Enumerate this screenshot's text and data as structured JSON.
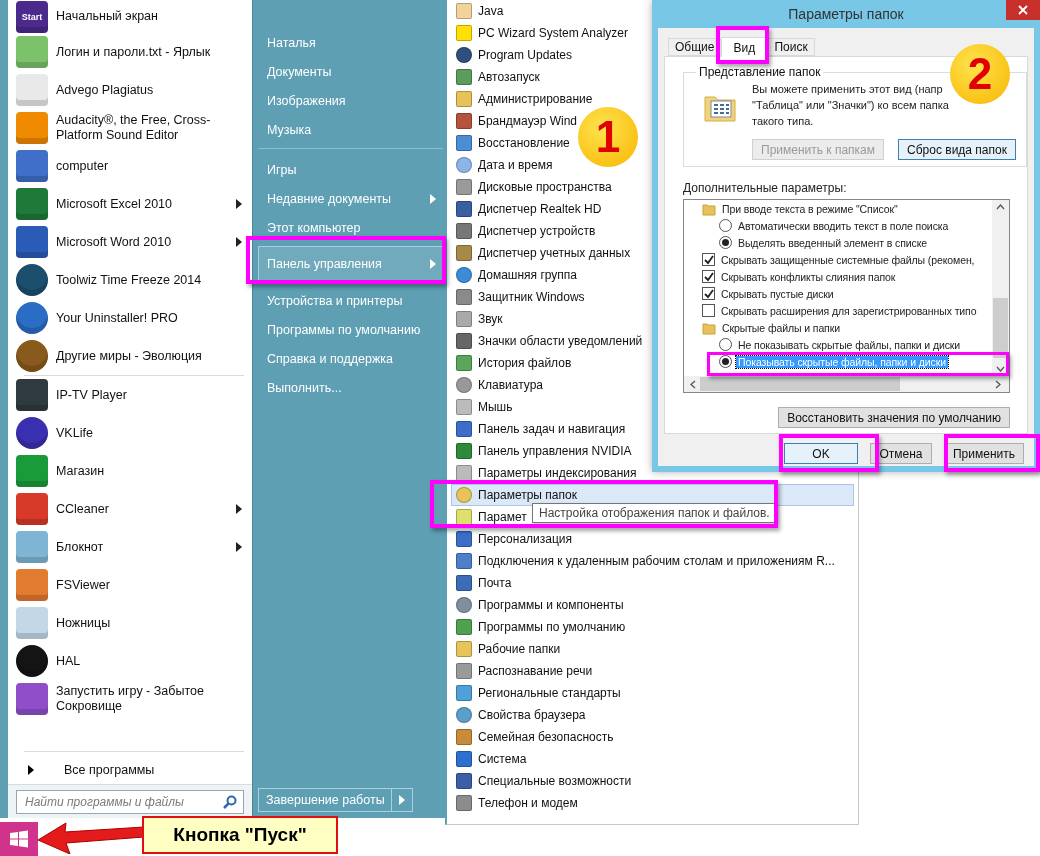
{
  "start_menu": {
    "pinned": [
      {
        "label": "Начальный экран",
        "icon_label": "Start",
        "submenu": false
      },
      {
        "label": "Логин и пароли.txt - Ярлык",
        "submenu": false
      },
      {
        "label": "Advego Plagiatus",
        "submenu": false
      },
      {
        "label": "Audacity®, the Free, Cross-Platform Sound Editor",
        "submenu": false
      },
      {
        "label": "computer",
        "submenu": false
      },
      {
        "label": "Microsoft Excel 2010",
        "submenu": true
      },
      {
        "label": "Microsoft Word 2010",
        "submenu": true
      },
      {
        "label": "Toolwiz Time Freeze 2014",
        "submenu": false
      },
      {
        "label": "Your Uninstaller! PRO",
        "submenu": false
      },
      {
        "label": "Другие миры - Эволюция",
        "submenu": false
      }
    ],
    "recent": [
      {
        "label": "IP-TV Player",
        "submenu": false
      },
      {
        "label": "VKLife",
        "submenu": false
      },
      {
        "label": "Магазин",
        "submenu": false
      },
      {
        "label": "CCleaner",
        "submenu": true
      },
      {
        "label": "Блокнот",
        "submenu": true
      },
      {
        "label": "FSViewer",
        "submenu": false
      },
      {
        "label": "Ножницы",
        "submenu": false
      },
      {
        "label": "HAL",
        "submenu": false
      },
      {
        "label": "Запустить игру - Забытое Сокровище",
        "submenu": false
      }
    ],
    "all_programs": "Все программы",
    "search": {
      "placeholder": "Найти программы и файлы"
    },
    "places": [
      [
        {
          "label": "Наталья",
          "submenu": false,
          "selected": false
        },
        {
          "label": "Документы",
          "submenu": false,
          "selected": false
        },
        {
          "label": "Изображения",
          "submenu": false,
          "selected": false
        },
        {
          "label": "Музыка",
          "submenu": false,
          "selected": false
        }
      ],
      [
        {
          "label": "Игры",
          "submenu": false,
          "selected": false
        },
        {
          "label": "Недавние документы",
          "submenu": true,
          "selected": false
        },
        {
          "label": "Этот компьютер",
          "submenu": false,
          "selected": false
        },
        {
          "label": "Панель управления",
          "submenu": true,
          "selected": true
        },
        {
          "label": "Устройства и принтеры",
          "submenu": false,
          "selected": false
        },
        {
          "label": "Программы по умолчанию",
          "submenu": false,
          "selected": false
        },
        {
          "label": "Справка и поддержка",
          "submenu": false,
          "selected": false
        },
        {
          "label": "Выполнить...",
          "submenu": false,
          "selected": false
        }
      ]
    ],
    "shutdown": "Завершение работы"
  },
  "control_panel": {
    "items": [
      {
        "label": "Java",
        "selected": false
      },
      {
        "label": "PC Wizard System Analyzer",
        "selected": false
      },
      {
        "label": "Program Updates",
        "selected": false
      },
      {
        "label": "Автозапуск",
        "selected": false
      },
      {
        "label": "Администрирование",
        "selected": false
      },
      {
        "label": "Брандмауэр Wind",
        "selected": false
      },
      {
        "label": "Восстановление",
        "selected": false
      },
      {
        "label": "Дата и время",
        "selected": false
      },
      {
        "label": "Дисковые пространства",
        "selected": false
      },
      {
        "label": "Диспетчер Realtek HD",
        "selected": false
      },
      {
        "label": "Диспетчер устройств",
        "selected": false
      },
      {
        "label": "Диспетчер учетных данных",
        "selected": false
      },
      {
        "label": "Домашняя группа",
        "selected": false
      },
      {
        "label": "Защитник Windows",
        "selected": false
      },
      {
        "label": "Звук",
        "selected": false
      },
      {
        "label": "Значки области уведомлений",
        "selected": false
      },
      {
        "label": "История файлов",
        "selected": false
      },
      {
        "label": "Клавиатура",
        "selected": false
      },
      {
        "label": "Мышь",
        "selected": false
      },
      {
        "label": "Панель задач и навигация",
        "selected": false
      },
      {
        "label": "Панель управления NVIDIA",
        "selected": false
      },
      {
        "label": "Параметры индексирования",
        "selected": false
      },
      {
        "label": "Параметры папок",
        "selected": true
      },
      {
        "label": "Парамет",
        "selected": false
      },
      {
        "label": "Персонализация",
        "selected": false
      },
      {
        "label": "Подключения к удаленным рабочим столам и приложениям R...",
        "selected": false
      },
      {
        "label": "Почта",
        "selected": false
      },
      {
        "label": "Программы и компоненты",
        "selected": false
      },
      {
        "label": "Программы по умолчанию",
        "selected": false
      },
      {
        "label": "Рабочие папки",
        "selected": false
      },
      {
        "label": "Распознавание речи",
        "selected": false
      },
      {
        "label": "Региональные стандарты",
        "selected": false
      },
      {
        "label": "Свойства браузера",
        "selected": false
      },
      {
        "label": "Семейная безопасность",
        "selected": false
      },
      {
        "label": "Система",
        "selected": false
      },
      {
        "label": "Специальные возможности",
        "selected": false
      },
      {
        "label": "Телефон и модем",
        "selected": false
      }
    ],
    "tooltip": "Настройка отображения папок и файлов."
  },
  "dialog": {
    "title": "Параметры папок",
    "tabs": [
      {
        "label": "Общие",
        "selected": false
      },
      {
        "label": "Вид",
        "selected": true
      },
      {
        "label": "Поиск",
        "selected": false
      }
    ],
    "folder_views": {
      "title": "Представление папок",
      "text": "Вы можете применить этот вид (напр\n\"Таблица\" или \"Значки\") ко всем папка\nтакого типа.",
      "buttons": [
        {
          "label": "Применить к папкам",
          "disabled": true,
          "focused": false
        },
        {
          "label": "Сброс вида папок",
          "disabled": false,
          "focused": true
        }
      ]
    },
    "advanced": {
      "label": "Дополнительные параметры:",
      "items": [
        {
          "kind": "folder",
          "label": "При вводе текста в режиме \"Список\"",
          "selected": false,
          "children": [
            {
              "kind": "radio",
              "label": "Автоматически вводить текст в поле поиска",
              "checked": false,
              "selected": false
            },
            {
              "kind": "radio",
              "label": "Выделять введенный элемент в списке",
              "checked": true,
              "selected": false
            }
          ]
        },
        {
          "kind": "checkbox",
          "label": "Скрывать защищенные системные файлы (рекомен,",
          "checked": true,
          "selected": false
        },
        {
          "kind": "checkbox",
          "label": "Скрывать конфликты слияния папок",
          "checked": true,
          "selected": false
        },
        {
          "kind": "checkbox",
          "label": "Скрывать пустые диски",
          "checked": true,
          "selected": false
        },
        {
          "kind": "checkbox",
          "label": "Скрывать расширения для зарегистрированных типо",
          "checked": false,
          "selected": false
        },
        {
          "kind": "folder",
          "label": "Скрытые файлы и папки",
          "selected": false,
          "children": [
            {
              "kind": "radio",
              "label": "Не показывать скрытые файлы, папки и диски",
              "checked": false,
              "selected": false
            },
            {
              "kind": "radio",
              "label": "Показывать скрытые файлы, папки и диски",
              "checked": true,
              "selected": true
            }
          ]
        }
      ]
    },
    "restore": "Восстановить значения по умолчанию",
    "footer": [
      {
        "label": "OK",
        "focused": true
      },
      {
        "label": "Отмена",
        "focused": false
      },
      {
        "label": "Применить",
        "focused": false
      }
    ]
  },
  "annotations": {
    "badges": [
      "1",
      "2"
    ],
    "callout": "Кнопка \"Пуск\""
  }
}
